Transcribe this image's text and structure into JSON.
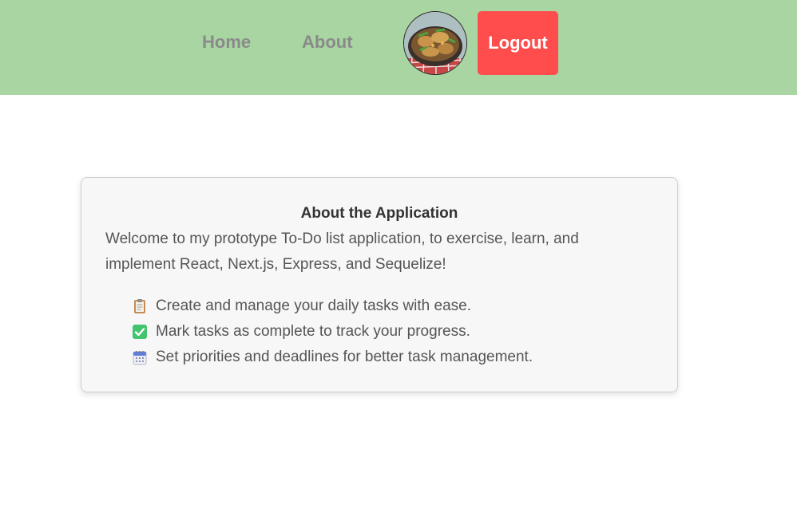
{
  "nav": {
    "links": [
      {
        "label": "Home"
      },
      {
        "label": "About"
      }
    ],
    "logout_label": "Logout"
  },
  "about": {
    "title": "About the Application",
    "description": "Welcome to my prototype To-Do list application, to exercise, learn, and implement React, Next.js, Express, and Sequelize!",
    "features": [
      {
        "icon": "clipboard-icon",
        "text": "Create and manage your daily tasks with ease."
      },
      {
        "icon": "check-mark-icon",
        "text": "Mark tasks as complete to track your progress."
      },
      {
        "icon": "calendar-icon",
        "text": "Set priorities and deadlines for better task management."
      }
    ]
  },
  "colors": {
    "navbar": "#a8d5a2",
    "nav_link": "#8a8a8a",
    "logout_button": "#ff4d4d",
    "card_background": "#f7f7f7",
    "text": "#555555"
  }
}
